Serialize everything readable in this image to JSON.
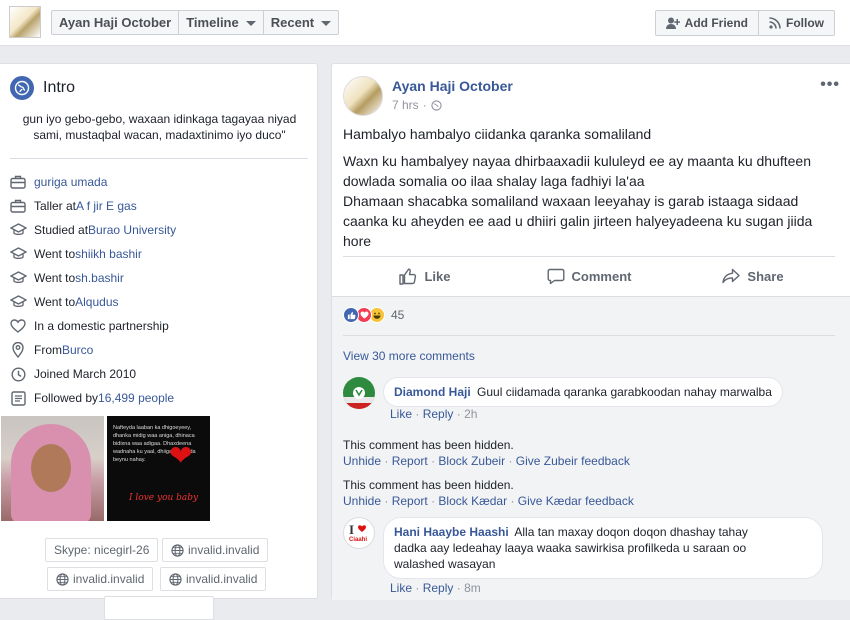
{
  "header": {
    "profile_name": "Ayan Haji October",
    "tabs": [
      {
        "label": "Timeline"
      },
      {
        "label": "Recent"
      }
    ],
    "add_friend_label": "Add Friend",
    "follow_label": "Follow"
  },
  "intro": {
    "title": "Intro",
    "bio": "gun iyo gebo-gebo, waxaan idinkaga tagayaa niyad sami, mustaqbal wacan, madaxtinimo iyo duco\"",
    "rows": [
      {
        "prefix": "",
        "link": "guriga umada",
        "icon": "briefcase-icon"
      },
      {
        "prefix": "Taller at ",
        "link": "A f jir E gas",
        "icon": "briefcase-icon"
      },
      {
        "prefix": "Studied at ",
        "link": "Burao University",
        "icon": "graduation-cap-icon"
      },
      {
        "prefix": "Went to ",
        "link": "shiikh bashir",
        "icon": "graduation-cap-icon"
      },
      {
        "prefix": "Went to ",
        "link": "sh.bashir",
        "icon": "graduation-cap-icon"
      },
      {
        "prefix": "Went to ",
        "link": "Alqudus",
        "icon": "graduation-cap-icon"
      },
      {
        "prefix": "In a domestic partnership",
        "link": "",
        "icon": "heart-icon"
      },
      {
        "prefix": "From ",
        "link": "Burco",
        "icon": "location-pin-icon"
      },
      {
        "prefix": "Joined March 2010",
        "link": "",
        "icon": "clock-icon"
      },
      {
        "prefix": "Followed by ",
        "link": "16,499 people",
        "icon": "followers-icon"
      }
    ],
    "photo2_text": "Nafteyda laaban ka dhigoeyeey, dhanka midig waa aniga, dhinaca bidixna waa adigaa. Dhaxdeena wadnaha ku yaal, dhiiga ku socda beynu nahay.",
    "photo2_caption": "I love you baby",
    "skype": "Skype: nicegirl-26",
    "web1": "invalid.invalid",
    "web2": "invalid.invalid",
    "web3": "invalid.invalid"
  },
  "post": {
    "author": "Ayan Haji October",
    "time": "7 hrs",
    "more": "•••",
    "para1": "Hambalyo hambalyo ciidanka qaranka somaliland",
    "para2_l1": "Waxn ku hambalyey nayaa dhirbaaxadii kululeyd ee ay maanta ku dhufteen",
    "para2_l2": "dowlada somalia oo ilaa shalay laga fadhiyi la'aa",
    "para2_l3": "Dhamaan shacabka somaliland waxaan leeyahay is garab istaaga sidaad",
    "para2_l4": "caanka ku aheyden ee aad u dhiiri galin jirteen halyeyadeena ku sugan jiida",
    "para2_l5": "hore",
    "like_label": "Like",
    "comment_label": "Comment",
    "share_label": "Share",
    "reaction_count": "45",
    "view_more": "View 30 more comments"
  },
  "comments": {
    "c1": {
      "author": "Diamond Haji",
      "text": "Guul ciidamada qaranka garabkoodan nahay marwalba",
      "like": "Like",
      "reply": "Reply",
      "time": "2h"
    },
    "h1": {
      "msg": "This comment has been hidden.",
      "unhide": "Unhide",
      "report": "Report",
      "block": "Block Zubeir",
      "feedback": "Give Zubeir feedback"
    },
    "h2": {
      "msg": "This comment has been hidden.",
      "unhide": "Unhide",
      "report": "Report",
      "block": "Block Kædar",
      "feedback": "Give Kædar feedback"
    },
    "c2": {
      "author": "Hani Haaybe Haashi",
      "text_l1": "Alla tan maxay doqon doqon dhashay tahay",
      "text_l2": "dadka aay ledeahay laaya waaka sawirkisa profilkeda u saraan oo",
      "text_l3": "walashed wasayan",
      "like": "Like",
      "reply": "Reply",
      "time": "8m",
      "avatar_text": "Ciaahi"
    }
  },
  "colors": {
    "link": "#385898",
    "brand": "#4267b2",
    "muted": "#90949c"
  }
}
